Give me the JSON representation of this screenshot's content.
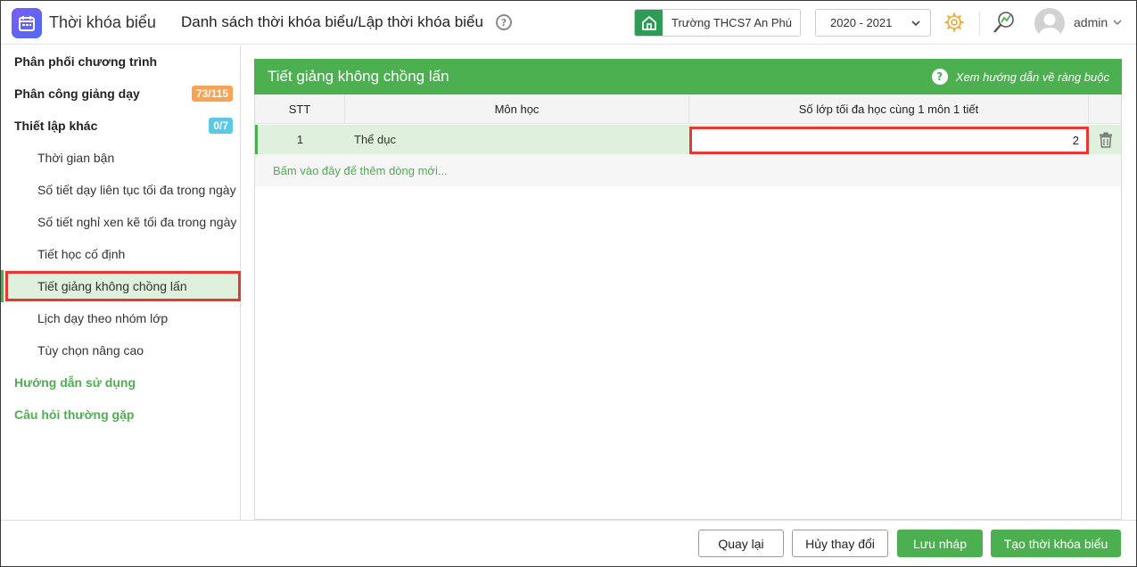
{
  "header": {
    "app_name": "Thời khóa biểu",
    "page_title": "Danh sách thời khóa biểu/Lập thời khóa biểu",
    "help_glyph": "?",
    "school": "Trường THCS7 An Phú",
    "school_year": "2020 - 2021",
    "username": "admin"
  },
  "sidebar": {
    "items": [
      {
        "label": "Phân phối chương trình"
      },
      {
        "label": "Phân công giảng dạy",
        "badge": "73/115"
      },
      {
        "label": "Thiết lập khác",
        "badge": "0/7"
      },
      {
        "label": "Thời gian bận"
      },
      {
        "label": "Số tiết dạy liên tục tối đa trong ngày"
      },
      {
        "label": "Số tiết nghỉ xen kẽ tối đa trong ngày"
      },
      {
        "label": "Tiết học cố định"
      },
      {
        "label": "Tiết giảng không chồng lấn"
      },
      {
        "label": "Lịch dạy theo nhóm lớp"
      },
      {
        "label": "Tùy chọn nâng cao"
      },
      {
        "label": "Hướng dẫn sử dụng"
      },
      {
        "label": "Câu hỏi thường gặp"
      }
    ]
  },
  "panel": {
    "title": "Tiết giảng không chồng lấn",
    "guide_icon_glyph": "?",
    "guide_link": "Xem hướng dẫn về ràng buộc",
    "columns": [
      "STT",
      "Môn học",
      "Số lớp tối đa học cùng 1 môn 1 tiết"
    ],
    "rows": [
      {
        "stt": "1",
        "subject": "Thể dục",
        "max_classes": "2"
      }
    ],
    "add_row_text": "Bấm vào đây để thêm dòng mới..."
  },
  "footer": {
    "back": "Quay lại",
    "cancel": "Hủy thay đổi",
    "save_draft": "Lưu nháp",
    "create": "Tạo thời khóa biểu"
  },
  "colors": {
    "accent_green": "#4caf50",
    "highlight_red": "#e53935",
    "badge_orange": "#f7a353",
    "badge_blue": "#5ac8e6"
  }
}
